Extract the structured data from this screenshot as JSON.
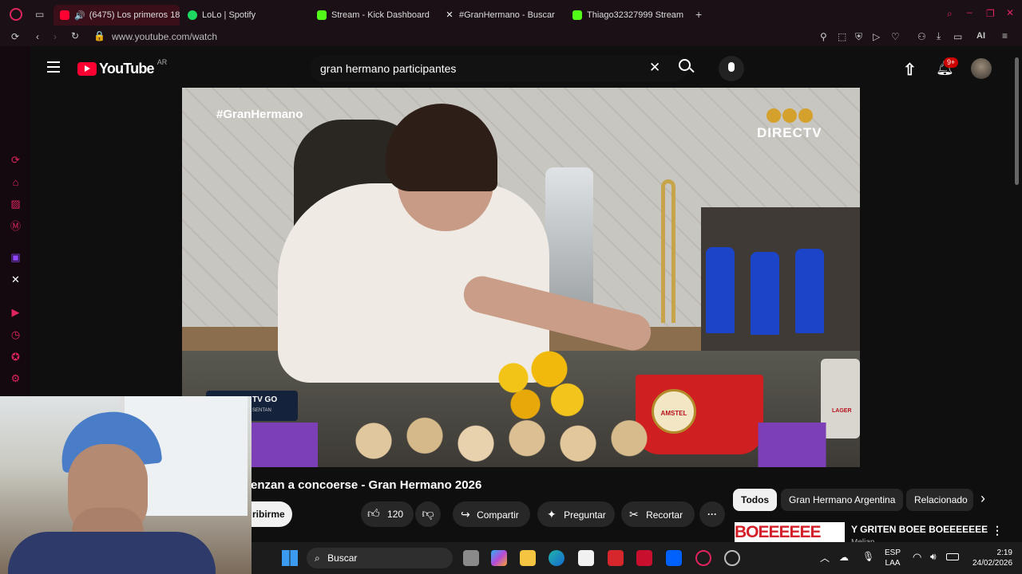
{
  "tabs": [
    {
      "label": "(6475) Los primeros 18",
      "color": "#ff0033"
    },
    {
      "label": "LoLo | Spotify",
      "color": "#1ed760"
    },
    {
      "label": "Stream - Kick Dashboard",
      "color": "#53fc18"
    },
    {
      "label": "#GranHermano - Buscar /",
      "color": "#ffffff"
    },
    {
      "label": "Thiago32327999 Stream -",
      "color": "#53fc18"
    }
  ],
  "address": {
    "url": "www.youtube.com/watch"
  },
  "browser_tools": {
    "ai_label": "AI"
  },
  "youtube": {
    "logo": "YouTube",
    "region": "AR",
    "search_value": "gran hermano participantes",
    "notif_count": "9+"
  },
  "video": {
    "hashtag": "#GranHermano",
    "brand": "DIRECTV",
    "bucket_label": "AMSTEL",
    "lager": "LAGER",
    "promo": "TV GO",
    "promo_sub": "SENTAN",
    "title": "enzan a concoerse - Gran Hermano 2026"
  },
  "actions": {
    "subscribe": "ribirme",
    "likes": "120",
    "share": "Compartir",
    "ask": "Preguntar",
    "clip": "Recortar"
  },
  "chips": [
    "Todos",
    "Gran Hermano Argentina",
    "Relacionado"
  ],
  "recommended": {
    "title": "Y GRITEN BOEE BOEEEEEEE",
    "channel": "Melian",
    "thumb_text": "BOEEEEEE"
  },
  "taskbar": {
    "search": "Buscar",
    "lang": "ESP",
    "layout": "LAA",
    "time": "2:19",
    "date": "24/02/2026"
  },
  "colors": {
    "brand": "#ff0033",
    "accent": "#e0245e"
  }
}
